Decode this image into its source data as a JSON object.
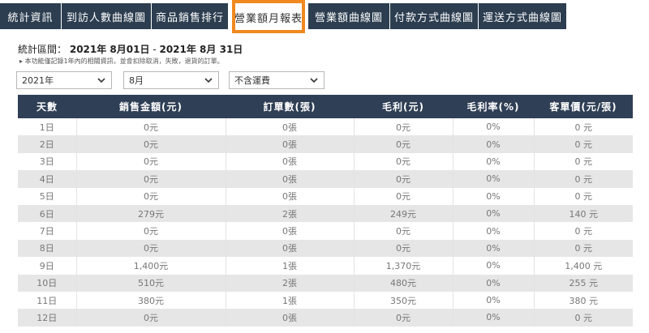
{
  "tabs": [
    {
      "label": "統計資訊",
      "active": false
    },
    {
      "label": "到訪人數曲線圖",
      "active": false
    },
    {
      "label": "商品銷售排行",
      "active": false
    },
    {
      "label": "營業額月報表",
      "active": true
    },
    {
      "label": "營業額曲線圖",
      "active": false
    },
    {
      "label": "付款方式曲線圖",
      "active": false
    },
    {
      "label": "運送方式曲線圖",
      "active": false
    }
  ],
  "range": {
    "label": "統計區間：",
    "start": "2021年 8月01日",
    "separator": "-",
    "end": "2021年 8月 31日"
  },
  "note": "▸ 本功能僅記錄1年內的相關資訊，並會扣除取消，失敗，退貨的訂單。",
  "filters": {
    "year": "2021年",
    "month": "8月",
    "shipping": "不含運費"
  },
  "colors": {
    "header": "#2f3f55",
    "tab": "#2c3e50",
    "highlight": "#f0891f"
  },
  "table": {
    "headers": [
      "天數",
      "銷售金額(元)",
      "訂單數(張)",
      "毛利(元)",
      "毛利率(%)",
      "客單價(元/張)"
    ],
    "rows": [
      [
        "1日",
        "0元",
        "0張",
        "0元",
        "0%",
        "0 元"
      ],
      [
        "2日",
        "0元",
        "0張",
        "0元",
        "0%",
        "0 元"
      ],
      [
        "3日",
        "0元",
        "0張",
        "0元",
        "0%",
        "0 元"
      ],
      [
        "4日",
        "0元",
        "0張",
        "0元",
        "0%",
        "0 元"
      ],
      [
        "5日",
        "0元",
        "0張",
        "0元",
        "0%",
        "0 元"
      ],
      [
        "6日",
        "279元",
        "2張",
        "249元",
        "0%",
        "140 元"
      ],
      [
        "7日",
        "0元",
        "0張",
        "0元",
        "0%",
        "0 元"
      ],
      [
        "8日",
        "0元",
        "0張",
        "0元",
        "0%",
        "0 元"
      ],
      [
        "9日",
        "1,400元",
        "1張",
        "1,370元",
        "0%",
        "1,400 元"
      ],
      [
        "10日",
        "510元",
        "2張",
        "480元",
        "0%",
        "255 元"
      ],
      [
        "11日",
        "380元",
        "1張",
        "350元",
        "0%",
        "380 元"
      ],
      [
        "12日",
        "0元",
        "0張",
        "0元",
        "0%",
        "0 元"
      ]
    ]
  }
}
